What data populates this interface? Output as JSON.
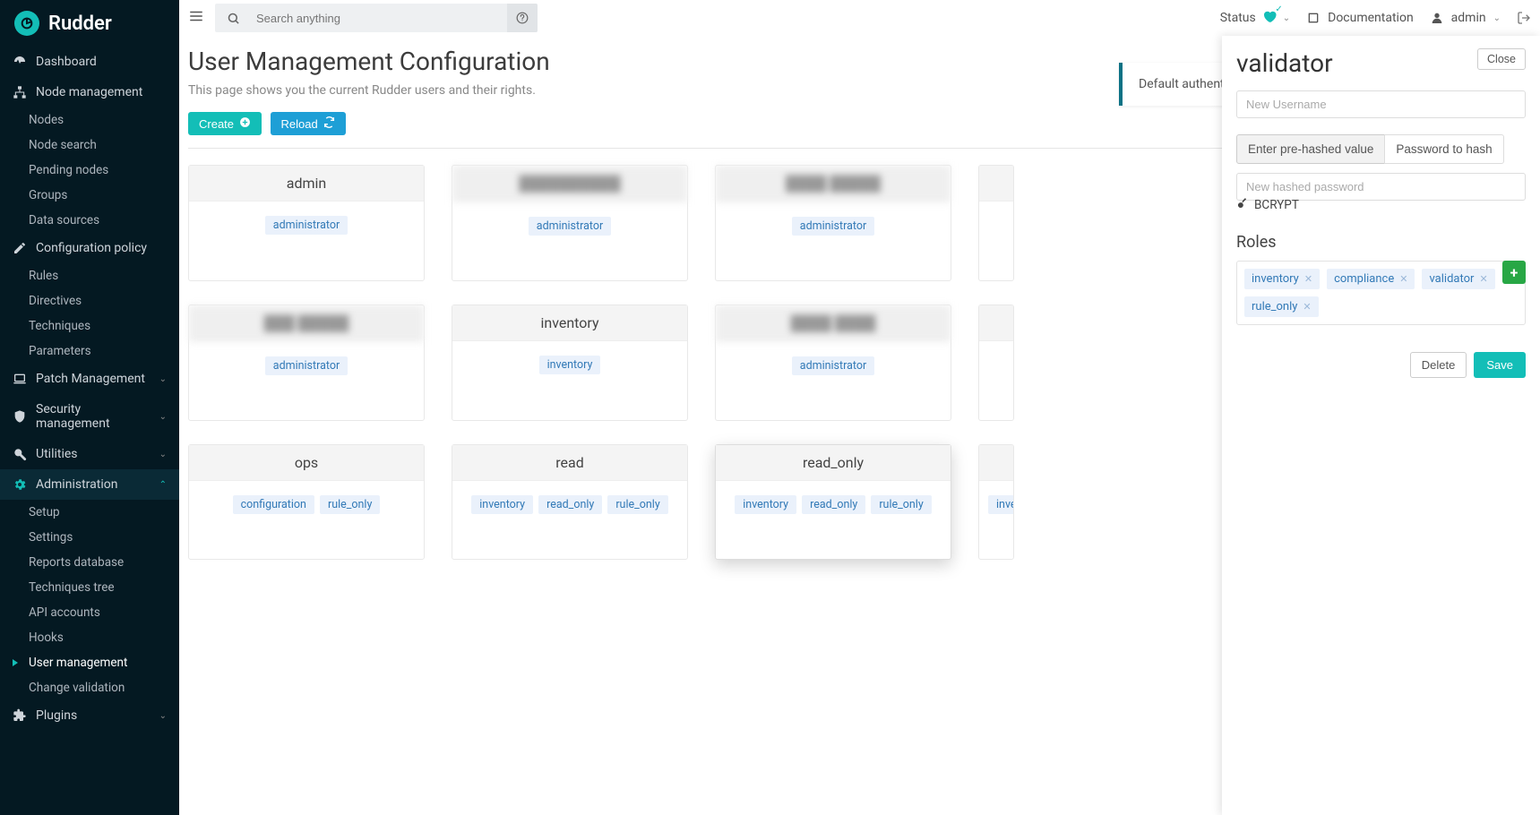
{
  "brand": "Rudder",
  "topbar": {
    "search_placeholder": "Search anything",
    "status_label": "Status",
    "doc_label": "Documentation",
    "user_label": "admin"
  },
  "sidebar": {
    "dashboard": "Dashboard",
    "node_mgmt": "Node management",
    "node_children": [
      "Nodes",
      "Node search",
      "Pending nodes",
      "Groups",
      "Data sources"
    ],
    "config_policy": "Configuration policy",
    "config_children": [
      "Rules",
      "Directives",
      "Techniques",
      "Parameters"
    ],
    "patch": "Patch Management",
    "security": "Security management",
    "utilities": "Utilities",
    "administration": "Administration",
    "admin_children": [
      "Setup",
      "Settings",
      "Reports database",
      "Techniques tree",
      "API accounts",
      "Hooks",
      "User management",
      "Change validation"
    ],
    "plugins": "Plugins"
  },
  "page": {
    "title": "User Management Configuration",
    "desc": "This page shows you the current Rudder users and their rights.",
    "create_btn": "Create",
    "reload_btn": "Reload",
    "banner": "Default authentic"
  },
  "users": [
    [
      {
        "name": "admin",
        "blurred": false,
        "roles": [
          "administrator"
        ]
      },
      {
        "name": "██████████",
        "blurred": true,
        "roles": [
          "administrator"
        ]
      },
      {
        "name": "████ █████",
        "blurred": true,
        "roles": [
          "administrator"
        ]
      },
      {
        "name": "",
        "blurred": false,
        "roles": [],
        "cut": true
      }
    ],
    [
      {
        "name": "███ █████",
        "blurred": true,
        "roles": [
          "administrator"
        ]
      },
      {
        "name": "inventory",
        "blurred": false,
        "roles": [
          "inventory"
        ]
      },
      {
        "name": "████ ████",
        "blurred": true,
        "roles": [
          "administrator"
        ]
      },
      {
        "name": "",
        "blurred": false,
        "roles": [],
        "cut": true
      }
    ],
    [
      {
        "name": "ops",
        "blurred": false,
        "roles": [
          "configuration",
          "rule_only"
        ]
      },
      {
        "name": "read",
        "blurred": false,
        "roles": [
          "inventory",
          "read_only",
          "rule_only"
        ]
      },
      {
        "name": "read_only",
        "blurred": false,
        "roles": [
          "inventory",
          "read_only",
          "rule_only"
        ],
        "selected": true
      },
      {
        "name": "",
        "blurred": false,
        "roles": [
          "invento"
        ],
        "cut": true
      }
    ]
  ],
  "panel": {
    "title": "validator",
    "close": "Close",
    "username_placeholder": "New Username",
    "tab_hashed": "Enter pre-hashed value",
    "tab_tohash": "Password to hash",
    "password_placeholder": "New hashed password",
    "hash_algo": "BCRYPT",
    "roles_label": "Roles",
    "roles": [
      "inventory",
      "compliance",
      "validator",
      "rule_only"
    ],
    "delete": "Delete",
    "save": "Save"
  }
}
